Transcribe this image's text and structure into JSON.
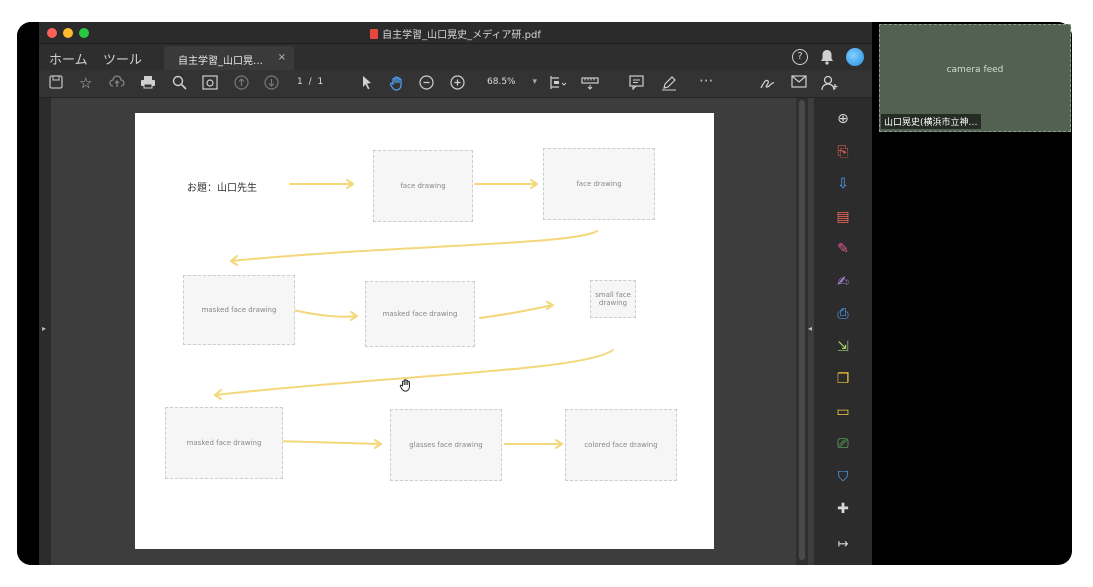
{
  "window": {
    "title": "自主学習_山口晃史_メディア研.pdf",
    "traffic_lights": [
      "#ff5f57",
      "#febc2e",
      "#28c840"
    ]
  },
  "tabbar": {
    "home": "ホーム",
    "tools": "ツール",
    "doc_tab": "自主学習_山口晃…",
    "close": "×",
    "help": "?",
    "bell_icon": "bell-icon"
  },
  "toolbar": {
    "page_current": "1",
    "page_sep": "/",
    "page_total": "1",
    "zoom": "68.5%",
    "zoom_caret": "▾"
  },
  "document": {
    "prompt": "お題：山口先生"
  },
  "figures": [
    {
      "label": "face drawing"
    },
    {
      "label": "face drawing"
    },
    {
      "label": "masked face drawing"
    },
    {
      "label": "masked face drawing"
    },
    {
      "label": "small face drawing"
    },
    {
      "label": "masked face drawing"
    },
    {
      "label": "glasses face drawing"
    },
    {
      "label": "colored face drawing"
    }
  ],
  "arrow_color": "#f3d77a",
  "right_panel_icons": [
    {
      "name": "zoom-icon",
      "glyph": "⊕",
      "color": "#d8d8d8"
    },
    {
      "name": "create-pdf-icon",
      "glyph": "⎘",
      "color": "#f2675b"
    },
    {
      "name": "export-pdf-icon",
      "glyph": "⇩",
      "color": "#4fa3ff"
    },
    {
      "name": "organize-pages-icon",
      "glyph": "▤",
      "color": "#f2675b"
    },
    {
      "name": "edit-pdf-icon",
      "glyph": "✎",
      "color": "#e75a9c"
    },
    {
      "name": "fill-sign-icon",
      "glyph": "✍",
      "color": "#b48cf2"
    },
    {
      "name": "send-review-icon",
      "glyph": "⎙",
      "color": "#4fa3ff"
    },
    {
      "name": "compress-icon",
      "glyph": "⇲",
      "color": "#a6d36b"
    },
    {
      "name": "combine-files-icon",
      "glyph": "❐",
      "color": "#f5c542"
    },
    {
      "name": "comment-icon",
      "glyph": "▭",
      "color": "#f5c542"
    },
    {
      "name": "print-production-icon",
      "glyph": "⎚",
      "color": "#6ad36b"
    },
    {
      "name": "protect-icon",
      "glyph": "⛉",
      "color": "#4fa3ff"
    },
    {
      "name": "more-tools-icon",
      "glyph": "✚",
      "color": "#d8d8d8"
    }
  ],
  "video": {
    "participant": "山口晃史(横浜市立神…"
  }
}
